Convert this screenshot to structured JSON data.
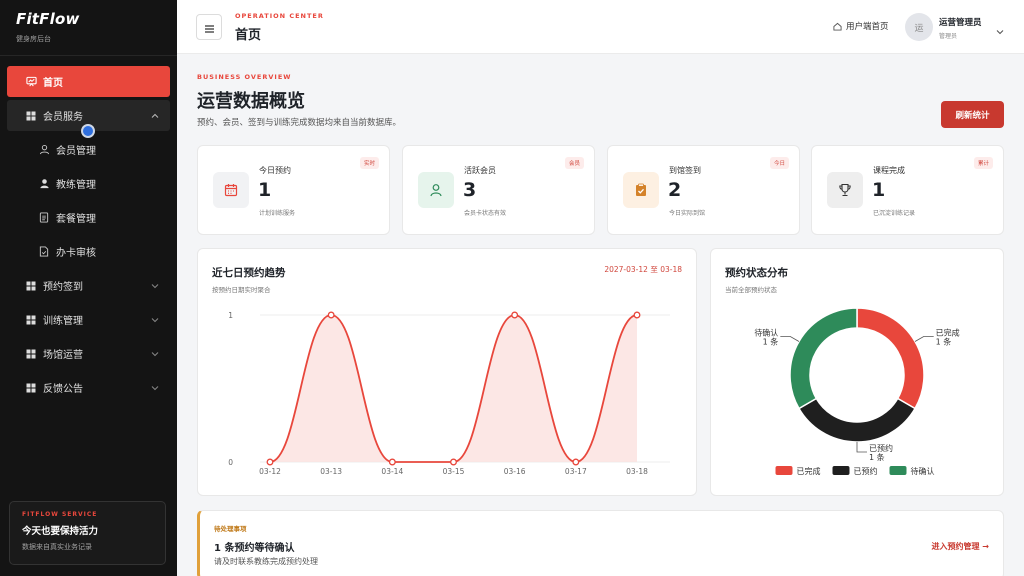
{
  "sidebar": {
    "brand_title": "FitFlow",
    "brand_subtitle": "健身房后台",
    "items": [
      {
        "label": "首页",
        "icon": "dashboard-icon"
      },
      {
        "label": "会员服务",
        "icon": "grid-icon"
      },
      {
        "label": "会员管理",
        "icon": "user-outline-icon"
      },
      {
        "label": "教练管理",
        "icon": "user-solid-icon"
      },
      {
        "label": "套餐管理",
        "icon": "document-icon"
      },
      {
        "label": "办卡审核",
        "icon": "document-check-icon"
      },
      {
        "label": "预约签到",
        "icon": "grid-icon"
      },
      {
        "label": "训练管理",
        "icon": "grid-icon"
      },
      {
        "label": "场馆运营",
        "icon": "grid-icon"
      },
      {
        "label": "反馈公告",
        "icon": "grid-icon"
      }
    ],
    "promo": {
      "tag": "FITFLOW SERVICE",
      "title": "今天也要保持活力",
      "subtitle": "数据来自真实业务记录"
    }
  },
  "header": {
    "eyebrow": "OPERATION CENTER",
    "title": "首页",
    "client_link": "用户端首页",
    "avatar_text": "运",
    "user_name": "运营管理员",
    "user_role": "管理员"
  },
  "overview": {
    "eyebrow": "BUSINESS OVERVIEW",
    "title": "运营数据概览",
    "description": "预约、会员、签到与训练完成数据均来自当前数据库。",
    "refresh_label": "刷新统计"
  },
  "stats": [
    {
      "label": "今日预约",
      "value": "1",
      "hint": "计划训练服务",
      "badge": "实时",
      "icon": "calendar-icon",
      "icon_color": "#e8473c",
      "icon_bg": "#f1f2f4"
    },
    {
      "label": "活跃会员",
      "value": "3",
      "hint": "会员卡状态有效",
      "badge": "会员",
      "icon": "user-outline-icon",
      "icon_color": "#2e8b5a",
      "icon_bg": "#e6f4ec"
    },
    {
      "label": "到馆签到",
      "value": "2",
      "hint": "今日实际到馆",
      "badge": "今日",
      "icon": "clipboard-check-icon",
      "icon_color": "#d4822a",
      "icon_bg": "#fdf0e2"
    },
    {
      "label": "课程完成",
      "value": "1",
      "hint": "已沉淀训练记录",
      "badge": "累计",
      "icon": "trophy-icon",
      "icon_color": "#333333",
      "icon_bg": "#eeeeee"
    }
  ],
  "trend_panel": {
    "title": "近七日预约趋势",
    "subtitle": "按预约日期实时聚合",
    "date_range": "2027-03-12 至 03-18"
  },
  "status_panel": {
    "title": "预约状态分布",
    "subtitle": "当前全部预约状态"
  },
  "chart_data": [
    {
      "type": "area",
      "x": [
        "03-12",
        "03-13",
        "03-14",
        "03-15",
        "03-16",
        "03-17",
        "03-18"
      ],
      "series": [
        {
          "values": [
            0,
            1,
            0,
            0,
            1,
            0,
            1
          ]
        }
      ],
      "ylim": [
        0,
        1
      ],
      "yticks": [
        "0",
        "1"
      ],
      "color": "#e8473c",
      "grid": true
    },
    {
      "type": "pie",
      "donut": true,
      "slices": [
        {
          "name": "已完成",
          "value": 1,
          "label": "已完成",
          "count_label": "1 条",
          "color": "#e8473c"
        },
        {
          "name": "已预约",
          "value": 1,
          "label": "已预约",
          "count_label": "1 条",
          "color": "#1f1f1f"
        },
        {
          "name": "待确认",
          "value": 1,
          "label": "待确认",
          "count_label": "1 条",
          "color": "#2e8b5a"
        }
      ],
      "legend": "bottom"
    }
  ],
  "todo": {
    "tag": "待处理事项",
    "title": "1 条预约等待确认",
    "subtitle": "请及时联系教练完成预约处理",
    "link": "进入预约管理 →"
  }
}
